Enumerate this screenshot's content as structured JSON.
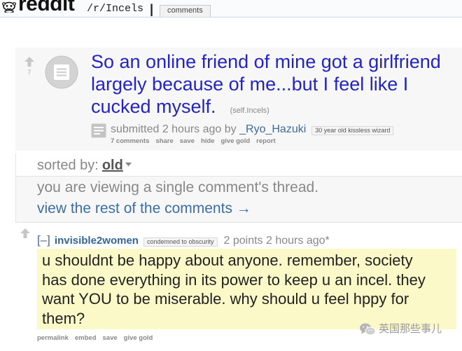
{
  "header": {
    "logo_text": "reddit",
    "subreddit": "/r/Incels",
    "separator": "|",
    "tabs": [
      {
        "label": "comments",
        "selected": true
      }
    ]
  },
  "post": {
    "score": "7",
    "title": "So an online friend of mine got a girlfriend largely because of me...but I feel like I cucked myself.",
    "domain": "(self.Incels)",
    "tagline_prefix": "submitted 2 hours ago by",
    "author": "_Ryo_Hazuki",
    "author_flair": "30 year old kissless wizard",
    "buttons": [
      "7 comments",
      "share",
      "save",
      "hide",
      "give gold",
      "report"
    ]
  },
  "sort": {
    "label": "sorted by:",
    "selected": "old"
  },
  "infobar": {
    "message": "you are viewing a single comment's thread.",
    "link": "view the rest of the comments →"
  },
  "comment": {
    "collapse": "[–]",
    "author": "invisible2women",
    "author_flair": "condemned to obscurity",
    "score": "2 points",
    "time": "2 hours ago",
    "edited_marker": "*",
    "body": "u shouldnt be happy about anyone. remember, society has done everything in its power to keep u an incel. they want YOU to be miserable. why should u feel hppy for them?",
    "buttons": [
      "permalink",
      "embed",
      "save",
      "give gold"
    ]
  },
  "watermark": {
    "text": "英国那些事儿",
    "icon": "wechat-icon"
  },
  "icons": {
    "logo": "reddit-alien-icon",
    "vote": "upvote-arrow-icon",
    "thumbnail": "self-post-thumbnail-icon",
    "expando": "self-text-expando-icon",
    "sort_dropdown": "dropdown-arrow-icon"
  },
  "colors": {
    "title": "#2424c6",
    "link": "#336699",
    "meta_text": "#888888",
    "vote_arrow": "#c6c6c6",
    "comment_highlight": "#fcf9c9",
    "post_background": "#f7f7f7"
  }
}
